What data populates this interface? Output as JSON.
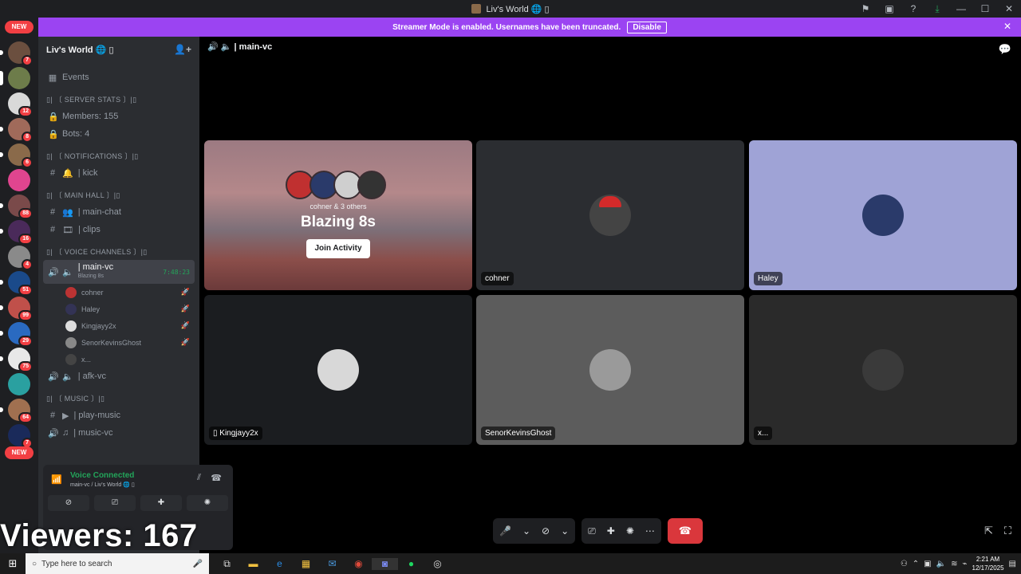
{
  "window": {
    "title": "Liv's World 🌐 ▯",
    "controls": [
      "minimize-icon",
      "maximize-icon",
      "close-icon"
    ]
  },
  "banner": {
    "text": "Streamer Mode is enabled. Usernames have been truncated.",
    "disable_label": "Disable"
  },
  "guilds": {
    "new_label": "NEW",
    "badges": [
      "7",
      "12",
      "8",
      "6",
      "88",
      "16",
      "4",
      "51",
      "99",
      "29",
      "75",
      "64",
      "7"
    ]
  },
  "server": {
    "name": "Liv's World 🌐 ▯",
    "events_label": "Events",
    "categories": {
      "stats": "▯| 〔 SERVER STATS 〕|▯",
      "notifications": "▯| 〔 NOTIFICATIONS 〕|▯",
      "main_hall": "▯| 〔 MAIN HALL 〕|▯",
      "voice": "▯| 〔 VOICE CHANNELS 〕|▯",
      "music": "▯| 〔 MUSIC 〕|▯"
    },
    "channels": {
      "members": "Members: 155",
      "bots": "Bots: 4",
      "kick": "| kick",
      "main_chat": "| main-chat",
      "clips": "| clips",
      "main_vc": "| main-vc",
      "main_vc_activity": "Blazing 8s",
      "main_vc_timer": "7:48:23",
      "afk_vc": "| afk-vc",
      "play_music": "| play-music",
      "music_vc": "| music-vc"
    },
    "vc_users": [
      "cohner",
      "Haley",
      "Kingjayy2x",
      "SenorKevinsGhost",
      "x..."
    ]
  },
  "voice_panel": {
    "status": "Voice Connected",
    "sub": "main-vc / Liv's World 🌐 ▯"
  },
  "stream_overlay": {
    "viewers": "Viewers: 167"
  },
  "call": {
    "channel_label": "| main-vc",
    "activity": {
      "sub": "cohner & 3 others",
      "title": "Blazing 8s",
      "join_label": "Join Activity"
    },
    "tiles": [
      {
        "name": "cohner",
        "bg": "#2b2d31"
      },
      {
        "name": "Haley",
        "bg": "#9fa3d6"
      },
      {
        "name": "Kingjayy2x",
        "bg": "#1b1d20"
      },
      {
        "name": "SenorKevinsGhost",
        "bg": "#5c5c5c"
      },
      {
        "name": "x...",
        "bg": "#2a2a2a"
      }
    ]
  },
  "taskbar": {
    "search_placeholder": "Type here to search",
    "time": "2:21 AM",
    "date": "12/17/2025"
  },
  "colors": {
    "accent": "#9b44f2",
    "online": "#23a55a",
    "danger": "#da373c"
  }
}
